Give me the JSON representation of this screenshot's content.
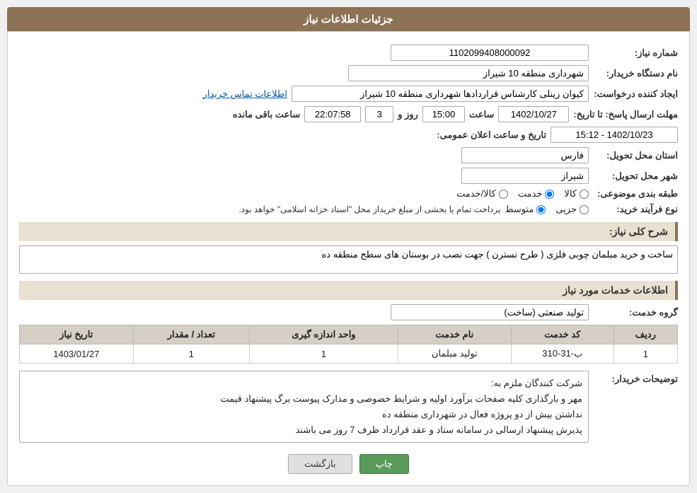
{
  "page": {
    "header": "جزئیات اطلاعات نیاز",
    "fields": {
      "request_number_label": "شماره نیاز:",
      "request_number_value": "1102099408000092",
      "org_name_label": "نام دستگاه خریدار:",
      "org_name_value": "شهرداری منطقه 10 شیراز",
      "creator_label": "ایجاد کننده درخواست:",
      "creator_value": "کیوان زینلی کارشناس قراردادها شهرداری منطقه 10 شیراز",
      "creator_link": "اطلاعات تماس خریدار",
      "deadline_label": "مهلت ارسال پاسخ: تا تاریخ:",
      "deadline_date": "1402/10/27",
      "deadline_time_label": "ساعت",
      "deadline_time": "15:00",
      "deadline_day_label": "روز و",
      "deadline_day": "3",
      "deadline_remaining_label": "ساعت باقی مانده",
      "deadline_remaining": "22:07:58",
      "public_date_label": "تاریخ و ساعت اعلان عمومی:",
      "public_date_value": "1402/10/23 - 15:12",
      "province_label": "استان محل تحویل:",
      "province_value": "فارس",
      "city_label": "شهر محل تحویل:",
      "city_value": "شیراز",
      "category_label": "طبقه بندی موضوعی:",
      "category_options": [
        "کالا",
        "خدمت",
        "کالا/خدمت"
      ],
      "category_selected": "خدمت",
      "purchase_type_label": "نوع فرآیند خرید:",
      "purchase_type_options": [
        "جزیی",
        "متوسط"
      ],
      "purchase_type_note": "پرداخت تمام یا بخشی از مبلغ خریداز محل \"اسناد خزانه اسلامی\" خواهد بود.",
      "description_label": "شرح کلی نیاز:",
      "description_value": "ساخت و خرید مبلمان چوبی فلزی ( طرح نسترن ) جهت نصب در بوستان های سطح منطقه ده",
      "services_title": "اطلاعات خدمات مورد نیاز",
      "service_group_label": "گروه خدمت:",
      "service_group_value": "تولید صنعتی (ساخت)",
      "table": {
        "headers": [
          "ردیف",
          "کد خدمت",
          "نام خدمت",
          "واحد اندازه گیری",
          "تعداد / مقدار",
          "تاریخ نیاز"
        ],
        "rows": [
          {
            "row": "1",
            "code": "ب-31-310",
            "name": "تولید مبلمان",
            "unit": "1",
            "quantity": "1",
            "date": "1403/01/27"
          }
        ]
      },
      "buyer_notes_label": "توضیحات خریدار:",
      "buyer_notes_line1": "شرکت کنندگان ملزم به:",
      "buyer_notes_line2": "مهر و بارگذاری کلیه صفحات برآورد اولیه و شرایط خصوصی و مدارک پیوست برگ پیشنهاد قیمت",
      "buyer_notes_line3": "نداشتن بیش از دو پروژه فعال در شهرداری منطقه ده",
      "buyer_notes_line4": "پذیرش پیشنهاد ارسالی در سامانه ستاد و عقد قرارداد ظرف 7 روز می باشند"
    },
    "buttons": {
      "print": "چاپ",
      "back": "بازگشت"
    }
  }
}
